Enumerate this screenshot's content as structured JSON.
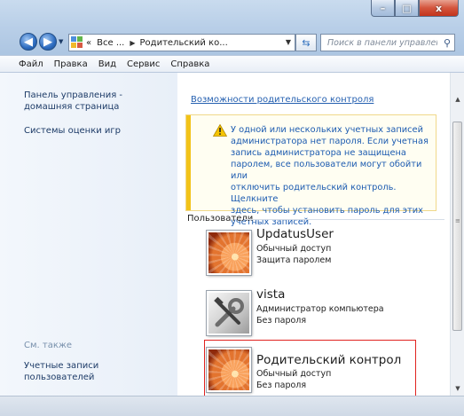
{
  "window": {
    "min_glyph": "–",
    "max_glyph": "□",
    "close_glyph": "x"
  },
  "nav": {
    "back_glyph": "◀",
    "forward_glyph": "▶",
    "address_segments": [
      "«",
      "Все ...",
      "Родительский ко..."
    ],
    "address_arrow": "▶",
    "search_placeholder": "Поиск в панели управления"
  },
  "menu": [
    "Файл",
    "Правка",
    "Вид",
    "Сервис",
    "Справка"
  ],
  "sidebar": {
    "home_line1": "Панель управления -",
    "home_line2": "домашняя страница",
    "ratings": "Системы оценки игр",
    "see_also": "См. также",
    "accounts_line1": "Учетные записи",
    "accounts_line2": "пользователей"
  },
  "main": {
    "parental_link": "Возможности родительского контроля",
    "warning_lines": [
      "У одной или нескольких учетных записей",
      "администратора нет пароля. Если учетная",
      "запись администратора не защищена",
      "паролем, все пользователи могут обойти или",
      "отключить родительский контроль. Щелкните",
      "здесь, чтобы установить пароль для этих",
      "учетных записей."
    ],
    "users_heading": "Пользователи",
    "users": [
      {
        "name": "UpdatusUser",
        "type": "Обычный доступ",
        "password": "Защита паролем",
        "avatar": "flower"
      },
      {
        "name": "vista",
        "type": "Администратор компьютера",
        "password": "Без пароля",
        "avatar": "tools"
      },
      {
        "name": "Родительский контрол",
        "type": "Обычный доступ",
        "password": "Без пароля",
        "avatar": "flower"
      }
    ]
  },
  "colors": {
    "link": "#2560b0",
    "warning_bar": "#f2c318",
    "selection": "#e0221f"
  }
}
